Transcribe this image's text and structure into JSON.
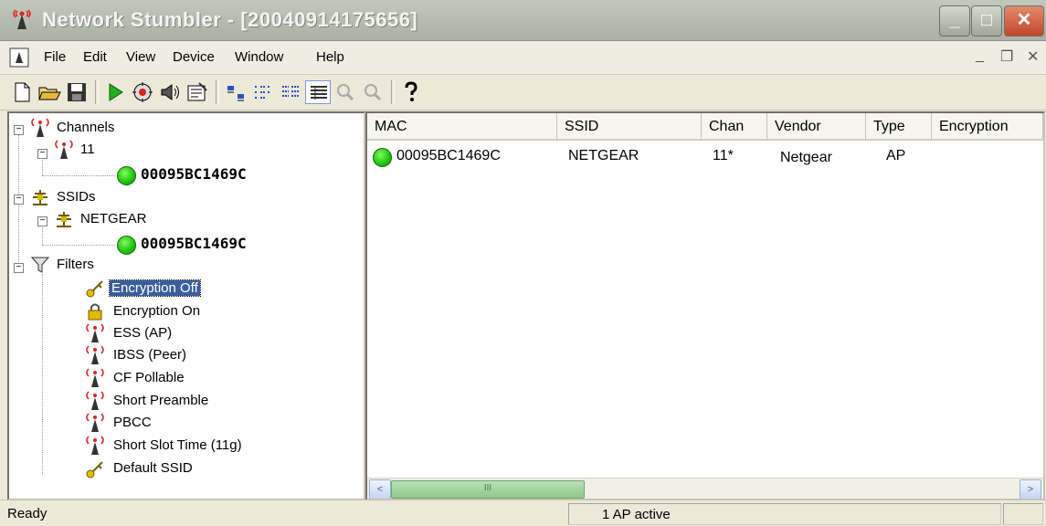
{
  "window": {
    "title": "Network Stumbler - [20040914175656]",
    "min_glyph": "_",
    "max_glyph": "□",
    "close_glyph": "✕"
  },
  "menu": {
    "items": [
      "File",
      "Edit",
      "View",
      "Device",
      "Window",
      "Help"
    ],
    "mdi_min": "_",
    "mdi_restore": "❐",
    "mdi_close": "✕"
  },
  "toolbar": {
    "buttons": [
      "new-icon",
      "open-icon",
      "save-icon",
      "play-icon",
      "scan-config-icon",
      "speaker-icon",
      "properties-icon",
      "large-icons-icon",
      "small-icons-icon",
      "list-icon",
      "details-icon",
      "zoom-in-icon",
      "zoom-out-icon",
      "help-icon"
    ]
  },
  "tree": {
    "channels": {
      "label": "Channels",
      "channel": "11",
      "ap_mac": "00095BC1469C"
    },
    "ssids": {
      "label": "SSIDs",
      "ssid": "NETGEAR",
      "ap_mac": "00095BC1469C"
    },
    "filters": {
      "label": "Filters",
      "items": [
        "Encryption Off",
        "Encryption On",
        "ESS (AP)",
        "IBSS (Peer)",
        "CF Pollable",
        "Short Preamble",
        "PBCC",
        "Short Slot Time (11g)",
        "Default SSID"
      ],
      "selected": "Encryption Off"
    }
  },
  "list": {
    "columns": [
      "MAC",
      "SSID",
      "Chan",
      "Vendor",
      "Type",
      "Encryption"
    ],
    "rows": [
      {
        "mac": "00095BC1469C",
        "ssid": "NETGEAR",
        "chan": "11*",
        "vendor": "Netgear",
        "type": "AP",
        "encryption": ""
      }
    ]
  },
  "scrollbar": {
    "left_arrow": "<",
    "right_arrow": ">",
    "thumb_grip": "III"
  },
  "status": {
    "left": "Ready",
    "middle": "1 AP active",
    "right": ""
  },
  "colors": {
    "active_dot": "#1fc00f",
    "selection": "#3a5e9b",
    "close_button": "#c1452c"
  }
}
